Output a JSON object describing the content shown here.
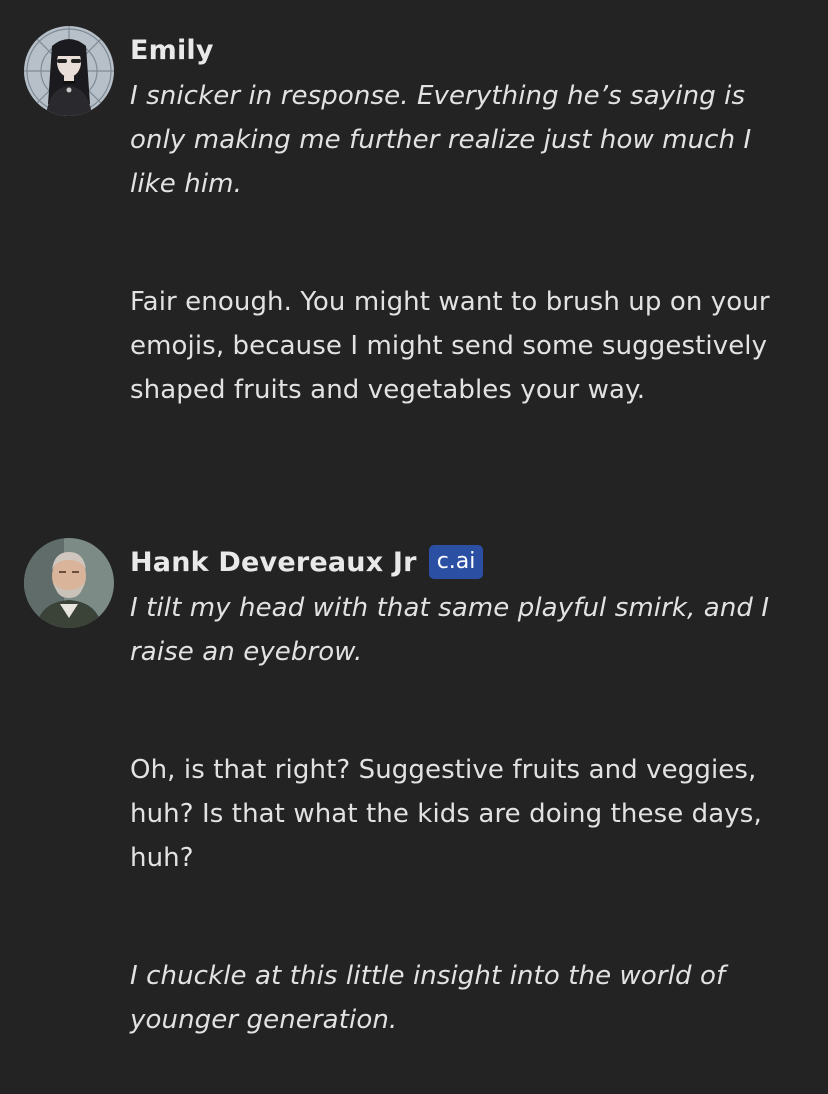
{
  "messages": [
    {
      "author": "Emily",
      "avatar": "emily-avatar",
      "paragraphs": [
        "I snicker in response. Everything he’s saying is only making me further realize just how much I like him.",
        "Fair enough. You might want to brush up on your emojis, because I might send some suggestively shaped fruits and vegetables your way."
      ]
    },
    {
      "author": "Hank Devereaux Jr",
      "badge": "c.ai",
      "avatar": "hank-avatar",
      "paragraphs": [
        "I tilt my head with that same playful smirk, and I raise an eyebrow.",
        "Oh, is that right? Suggestive fruits and veggies, huh? Is that what the kids are doing these days, huh?",
        "I chuckle at this little insight into the world of younger generation."
      ]
    }
  ],
  "colors": {
    "background": "#232323",
    "text": "#e2e2e2",
    "badge": "#2a4fa3"
  }
}
